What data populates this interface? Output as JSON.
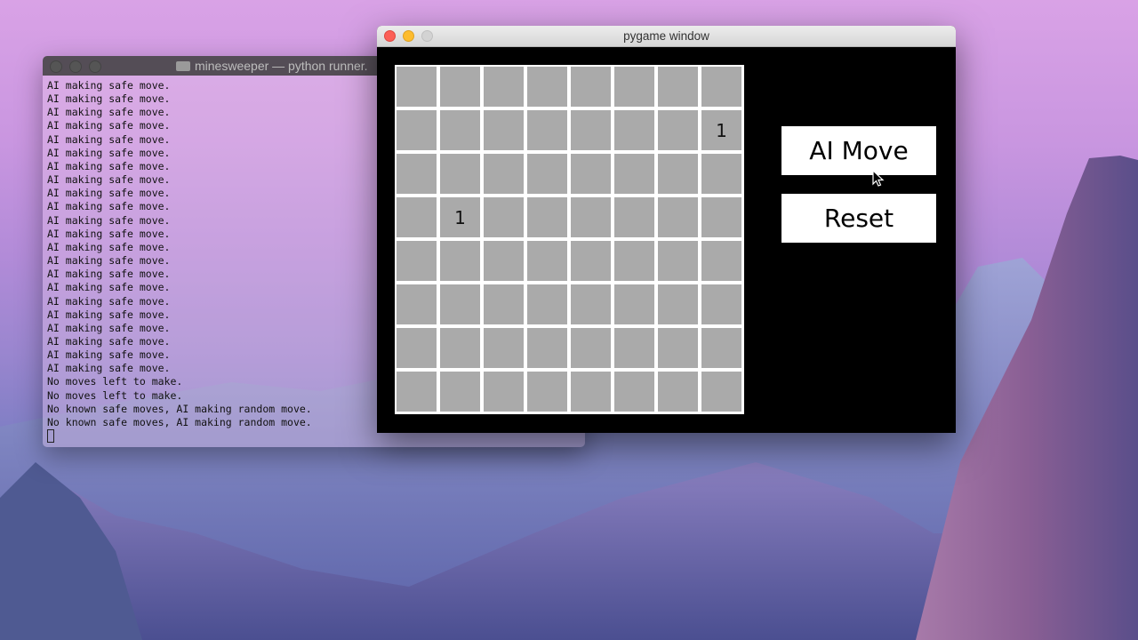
{
  "terminal": {
    "title": "minesweeper — python runner.",
    "lines": [
      "AI making safe move.",
      "AI making safe move.",
      "AI making safe move.",
      "AI making safe move.",
      "AI making safe move.",
      "AI making safe move.",
      "AI making safe move.",
      "AI making safe move.",
      "AI making safe move.",
      "AI making safe move.",
      "AI making safe move.",
      "AI making safe move.",
      "AI making safe move.",
      "AI making safe move.",
      "AI making safe move.",
      "AI making safe move.",
      "AI making safe move.",
      "AI making safe move.",
      "AI making safe move.",
      "AI making safe move.",
      "AI making safe move.",
      "AI making safe move.",
      "No moves left to make.",
      "No moves left to make.",
      "No known safe moves, AI making random move.",
      "No known safe moves, AI making random move."
    ]
  },
  "pygame": {
    "title": "pygame window",
    "board": {
      "rows": 8,
      "cols": 8,
      "revealed": [
        {
          "row": 1,
          "col": 7,
          "value": "1"
        },
        {
          "row": 3,
          "col": 1,
          "value": "1"
        }
      ]
    },
    "ai_move_label": "AI Move",
    "reset_label": "Reset"
  },
  "colors": {
    "cell": "#aaaaaa",
    "grid": "#ffffff",
    "window_bg": "#000000"
  }
}
